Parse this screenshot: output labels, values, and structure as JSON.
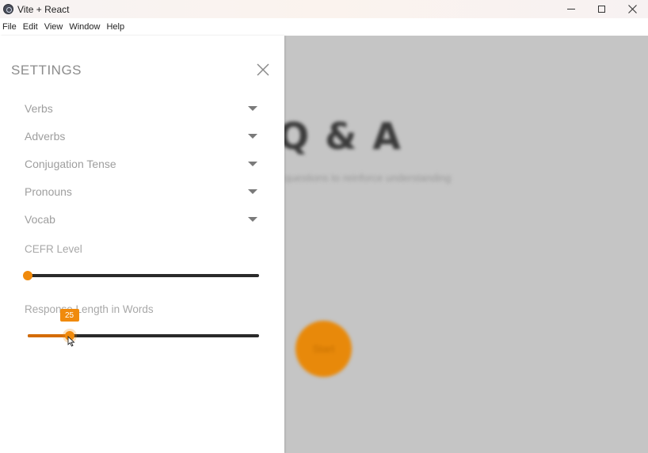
{
  "window": {
    "title": "Vite + React",
    "controls": [
      "minimize",
      "maximize",
      "close"
    ]
  },
  "menu": {
    "items": [
      "File",
      "Edit",
      "View",
      "Window",
      "Help"
    ]
  },
  "settings": {
    "title": "SETTINGS",
    "dropdowns": [
      {
        "label": "Verbs"
      },
      {
        "label": "Adverbs"
      },
      {
        "label": "Conjugation Tense"
      },
      {
        "label": "Pronouns"
      },
      {
        "label": "Vocab"
      }
    ],
    "cefr": {
      "label": "CEFR Level",
      "value_fraction": 0.0
    },
    "response_length": {
      "label": "Response Length in Words",
      "value": "25",
      "value_fraction": 0.18
    }
  },
  "background": {
    "title": "Q & A",
    "subtitle": "questions to reinforce understanding",
    "button_label": "Start"
  },
  "colors": {
    "accent": "#f08a0c",
    "track": "#2a2a2a",
    "overlay": "#c5c5c5"
  }
}
